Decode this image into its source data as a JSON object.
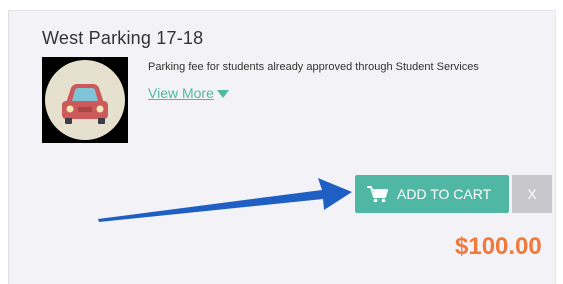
{
  "product": {
    "title": "West Parking 17-18",
    "description": "Parking fee for students already approved through Student Services",
    "view_more_label": "View More",
    "price": "$100.00"
  },
  "actions": {
    "add_to_cart_label": "ADD TO CART",
    "remove_label": "X"
  },
  "icons": {
    "thumbnail": "car-icon",
    "cart": "shopping-cart-icon",
    "expand": "caret-down-icon",
    "annotation": "pointer-arrow"
  },
  "colors": {
    "accent": "#4fb7a3",
    "price": "#f0793c",
    "remove_button": "#c8c8cc",
    "card_background": "#f3f2f7",
    "arrow": "#1f5fc4"
  }
}
